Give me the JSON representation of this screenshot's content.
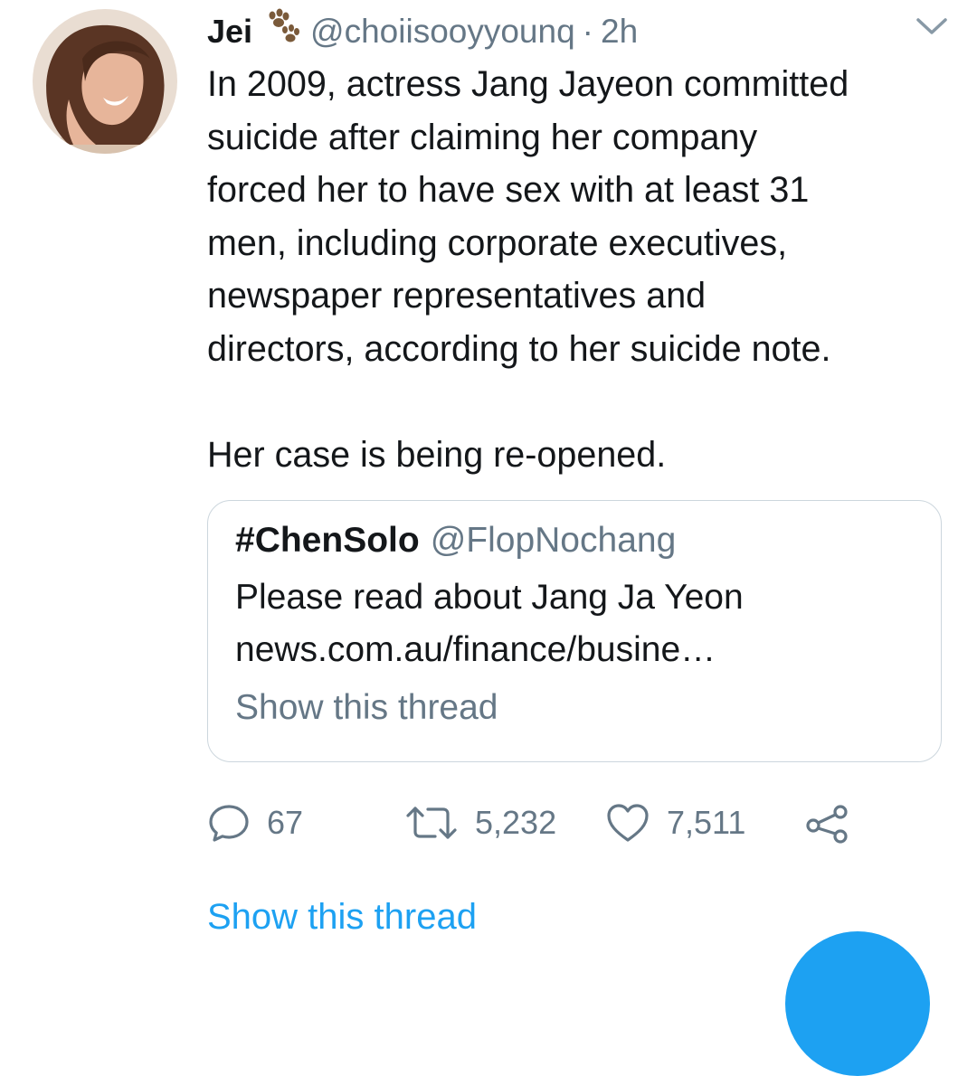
{
  "tweet": {
    "author_name": "Jei",
    "handle": "@choiisooyyounq",
    "separator": "·",
    "time": "2h",
    "text": "In 2009, actress Jang Jayeon committed\nsuicide after claiming her company\nforced her to have sex with at least 31\nmen, including corporate executives,\nnewspaper representatives and\ndirectors, according to her suicide note.\n\nHer case is being re-opened."
  },
  "quote": {
    "name": "#ChenSolo",
    "handle": "@FlopNochang",
    "text": "Please read about Jang Ja Yeon",
    "link": "news.com.au/finance/busine…",
    "show_thread": "Show this thread"
  },
  "actions": {
    "replies": "67",
    "retweets": "5,232",
    "likes": "7,511"
  },
  "show_thread": "Show this thread",
  "icons": [
    "paw-icon",
    "chevron-down-icon",
    "reply-icon",
    "retweet-icon",
    "like-icon",
    "share-icon"
  ],
  "colors": {
    "link_blue": "#1da1f2",
    "secondary_text": "#657786",
    "border": "#ccd6dd"
  }
}
